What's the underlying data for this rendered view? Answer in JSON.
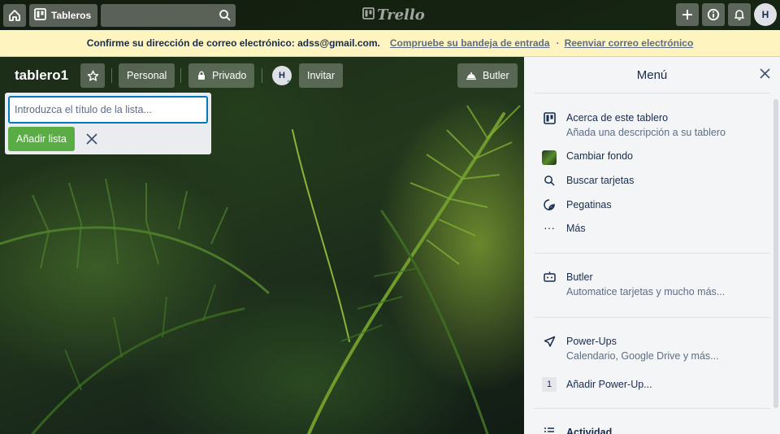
{
  "topbar": {
    "boards_label": "Tableros",
    "logo_text": "Trello",
    "avatar_initial": "H",
    "icons": [
      "home-icon",
      "boards-icon",
      "search-icon",
      "plus-icon",
      "info-icon",
      "bell-icon"
    ]
  },
  "banner": {
    "message": "Confirme su dirección de correo electrónico: adss@gmail.com.",
    "link_check": "Compruebe su bandeja de entrada",
    "separator": "·",
    "link_resend": "Reenviar correo electrónico"
  },
  "board": {
    "title": "tablero1",
    "team_label": "Personal",
    "visibility_label": "Privado",
    "member_initial": "H",
    "invite_label": "Invitar",
    "butler_label": "Butler"
  },
  "composer": {
    "placeholder": "Introduzca el título de la lista...",
    "add_label": "Añadir lista"
  },
  "menu": {
    "title": "Menú",
    "about": {
      "title": "Acerca de este tablero",
      "subtitle": "Añada una descripción a su tablero"
    },
    "change_bg": "Cambiar fondo",
    "search_cards": "Buscar tarjetas",
    "stickers": "Pegatinas",
    "more": "Más",
    "butler": {
      "title": "Butler",
      "subtitle": "Automatice tarjetas y mucho más..."
    },
    "powerups": {
      "title": "Power-Ups",
      "subtitle": "Calendario, Google Drive y más..."
    },
    "add_powerup": {
      "count": "1",
      "label": "Añadir Power-Up..."
    },
    "activity": "Actividad"
  },
  "colors": {
    "banner_bg": "#fdf4c0",
    "add_button": "#5aac44",
    "input_border": "#0079bf",
    "menu_bg": "#f4f5f7"
  }
}
